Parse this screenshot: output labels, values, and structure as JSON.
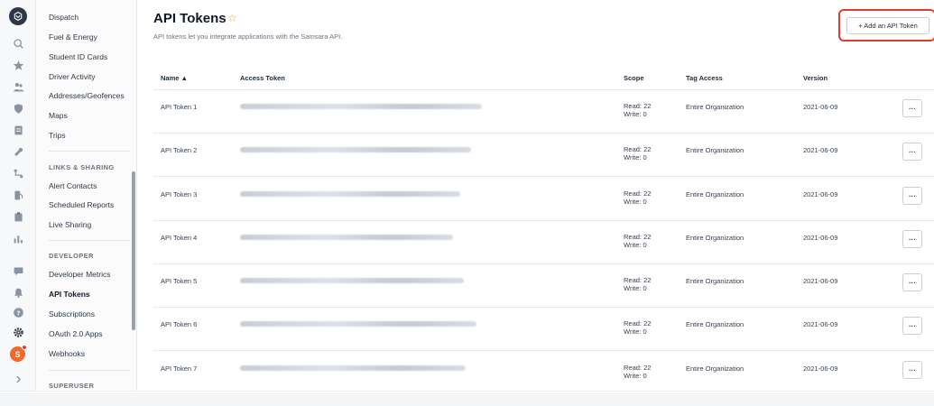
{
  "rail": {
    "icons": [
      "logo-icon",
      "search-icon",
      "star-icon",
      "people-icon",
      "shield-icon",
      "document-icon",
      "wrench-icon",
      "route-icon",
      "fuel-icon",
      "clipboard-icon",
      "chart-icon",
      "chat-icon",
      "bell-icon",
      "help-icon",
      "gear-icon",
      "chevron-right-icon"
    ],
    "avatar_letter": "S",
    "colors": {
      "avatar": "#f06a2a",
      "badge": "#e53e3e"
    }
  },
  "nav": {
    "items_top": [
      "Dispatch",
      "Fuel & Energy",
      "Student ID Cards",
      "Driver Activity",
      "Addresses/Geofences",
      "Maps",
      "Trips"
    ],
    "section_links": "LINKS & SHARING",
    "items_links": [
      "Alert Contacts",
      "Scheduled Reports",
      "Live Sharing"
    ],
    "section_developer": "DEVELOPER",
    "items_developer": [
      "Developer Metrics",
      "API Tokens",
      "Subscriptions",
      "OAuth 2.0 Apps",
      "Webhooks"
    ],
    "section_superuser": "SUPERUSER"
  },
  "header": {
    "title": "API Tokens",
    "star": "☆",
    "subtitle": "API tokens let you integrate applications with the Samsara API.",
    "add_button": "+ Add an API Token",
    "highlight_color": "#e53a2e"
  },
  "table": {
    "columns": [
      "Name ▲",
      "Access Token",
      "Scope",
      "Tag Access",
      "Version"
    ],
    "rows": [
      {
        "name": "API Token 1",
        "read": "Read: 22",
        "write": "Write: 0",
        "tag_access": "Entire Organization",
        "version": "2021-06-09",
        "more": "···"
      },
      {
        "name": "API Token 2",
        "read": "Read: 22",
        "write": "Write: 0",
        "tag_access": "Entire Organization",
        "version": "2021-06-09",
        "more": "···"
      },
      {
        "name": "API Token 3",
        "read": "Read: 22",
        "write": "Write: 0",
        "tag_access": "Entire Organization",
        "version": "2021-06-09",
        "more": "···"
      },
      {
        "name": "API Token 4",
        "read": "Read: 22",
        "write": "Write: 0",
        "tag_access": "Entire Organization",
        "version": "2021-06-09",
        "more": "···"
      },
      {
        "name": "API Token 5",
        "read": "Read: 22",
        "write": "Write: 0",
        "tag_access": "Entire Organization",
        "version": "2021-06-09",
        "more": "···"
      },
      {
        "name": "API Token 6",
        "read": "Read: 22",
        "write": "Write: 0",
        "tag_access": "Entire Organization",
        "version": "2021-06-09",
        "more": "···"
      },
      {
        "name": "API Token 7",
        "read": "Read: 22",
        "write": "Write: 0",
        "tag_access": "Entire Organization",
        "version": "2021-06-09",
        "more": "···"
      }
    ]
  }
}
